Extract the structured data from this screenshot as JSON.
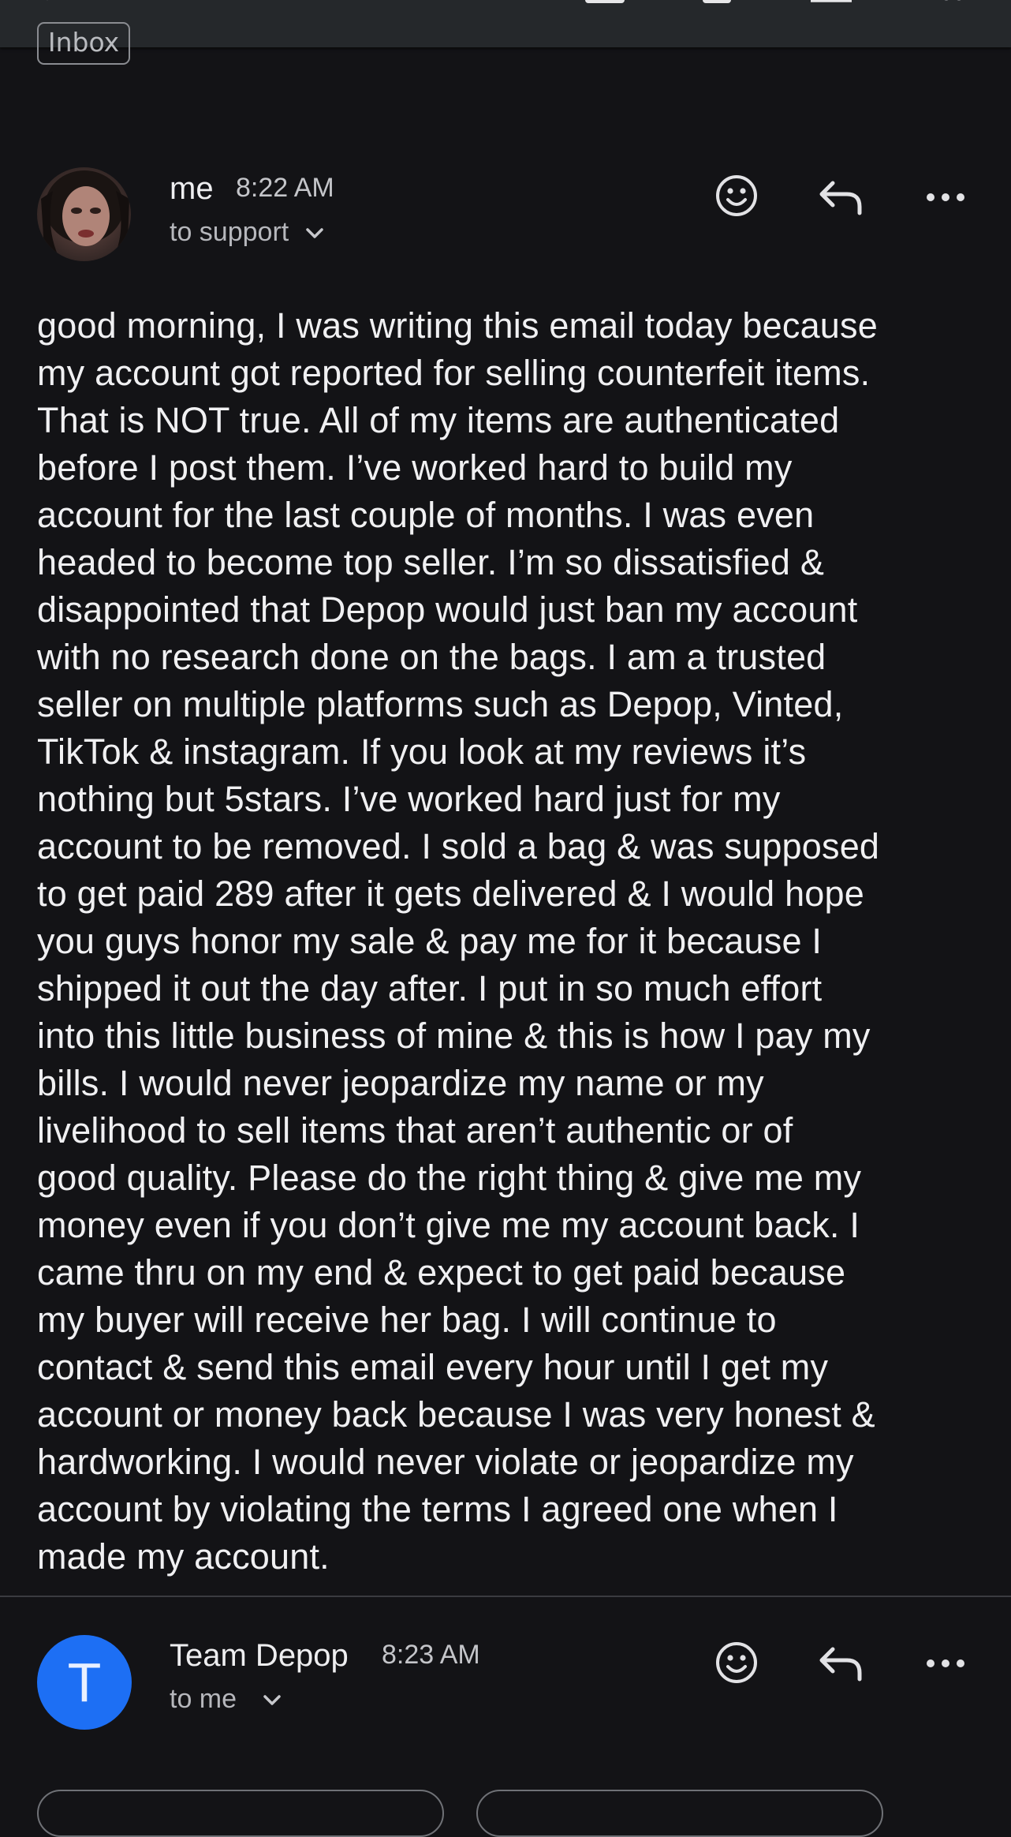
{
  "header": {
    "icons": [
      "back-icon",
      "archive-icon",
      "delete-icon",
      "mail-icon",
      "more-vert-icon"
    ]
  },
  "label_chip": "Inbox",
  "messages": [
    {
      "sender": "me",
      "time": "8:22 AM",
      "recipient": "to support",
      "avatar": "profile-photo",
      "body": "good morning, I was writing this email today because\nmy account got reported for selling counterfeit items.\nThat is NOT true. All of my items are authenticated\nbefore I post them. I’ve worked hard to build my\naccount for the last couple of months. I was even\nheaded to become top seller. I’m so dissatisfied &\ndisappointed that Depop would just ban my account\nwith no research done on the bags. I am a trusted\nseller on multiple platforms such as Depop, Vinted,\nTikTok & instagram. If you look at my reviews it’s\nnothing but 5stars. I’ve worked hard just for my\naccount to be removed. I sold a bag & was supposed\nto get paid 289 after it gets delivered & I would hope\nyou guys honor my sale & pay me for it because I\nshipped it out the day after. I put in so much effort\ninto this little business of mine & this is how I pay my\nbills. I would never jeopardize my name or my\nlivelihood to sell items that aren’t authentic or of\ngood quality. Please do the right thing & give me my\nmoney even if you don’t give me my account back. I\ncame thru on my end & expect to get paid because\nmy buyer will receive her bag. I will continue to\ncontact & send this email every hour until I get my\naccount or money back because I was very honest &\nhardworking. I would never violate or jeopardize my\naccount by violating the terms I agreed one when I\nmade my account."
    },
    {
      "sender": "Team Depop",
      "time": "8:23 AM",
      "recipient": "to me",
      "avatar_letter": "T",
      "avatar_color": "#1d6ff4"
    }
  ],
  "colors": {
    "background": "#131316",
    "toolbar": "#25282b",
    "text": "#f0f0f2",
    "secondary_text": "#b6b7bc",
    "accent": "#1d6ff4"
  }
}
